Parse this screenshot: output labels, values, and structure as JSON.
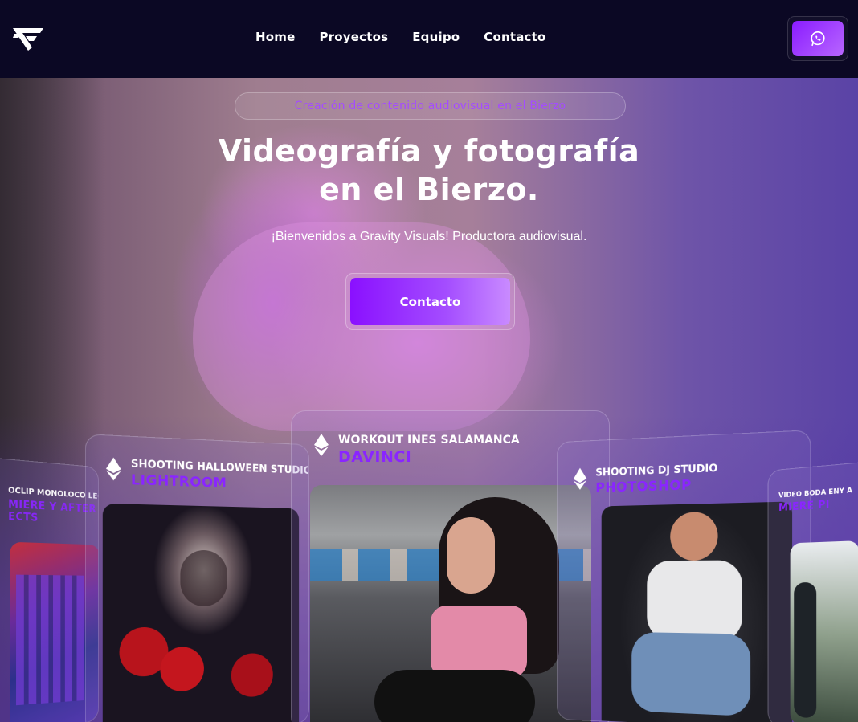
{
  "nav": {
    "logo_alt": "Gravity Visuals logo",
    "links": [
      "Home",
      "Proyectos",
      "Equipo",
      "Contacto"
    ],
    "whatsapp_icon": "whatsapp-icon"
  },
  "hero": {
    "badge": "Creación de contenido audiovisual en el Bierzo",
    "title_line1": "Videografía y fotografía",
    "title_line2": "en el Bierzo.",
    "subtitle": "¡Bienvenidos a Gravity Visuals! Productora audiovisual.",
    "cta_label": "Contacto"
  },
  "cards": {
    "far_left": {
      "title": "VIDEOCLIP MONOLOCO LEÓN",
      "title_visible": "OCLIP MONOLOCO LEÓN",
      "tool_line1": "MIERE Y AFTER",
      "tool_line2": "ECTS"
    },
    "left": {
      "title": "SHOOTING HALLOWEEN STUDIO",
      "tool": "LIGHTROOM"
    },
    "center": {
      "title": "WORKOUT INES SALAMANCA",
      "tool": "DAVINCI"
    },
    "right": {
      "title": "SHOOTING DJ STUDIO",
      "tool": "PHOTOSHOP",
      "tool_visible": "OTOSHOP"
    },
    "far_right": {
      "title": "VIDEO BODA ENY A",
      "title_visible": "VIDEO BODA ENY A",
      "tool": "MIERE PI"
    }
  },
  "colors": {
    "nav_bg": "#0b0824",
    "accent": "#8a10ff",
    "tool_text": "#8a25ff",
    "badge_text": "#a44cff"
  }
}
